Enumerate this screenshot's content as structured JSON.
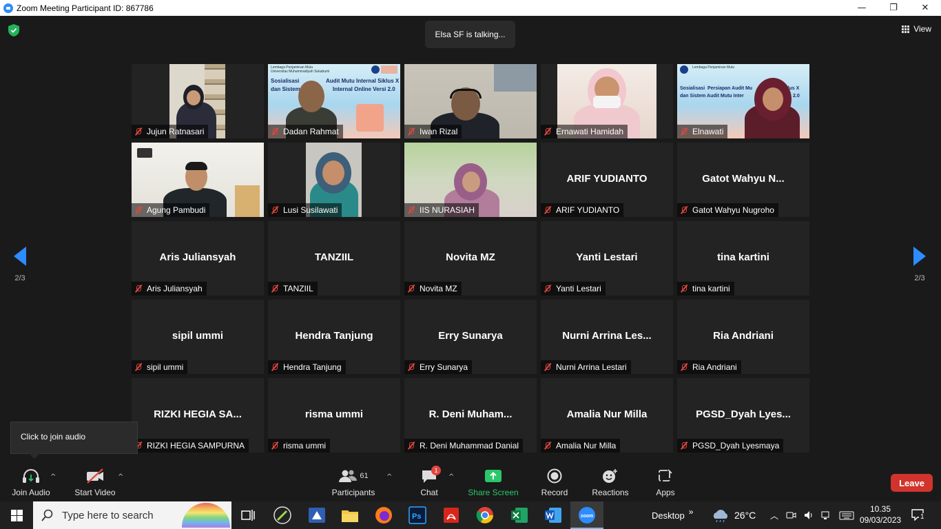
{
  "window": {
    "title": "Zoom Meeting Participant ID: 867786",
    "minimize": "—",
    "restore": "❐",
    "close": "✕"
  },
  "meeting": {
    "talking": "Elsa SF is talking...",
    "view_label": "View",
    "page_left": "2/3",
    "page_right": "2/3"
  },
  "participants": [
    {
      "name": "Jujun Ratnasari",
      "video": true,
      "bg": "#d8d4c8"
    },
    {
      "name": "Dadan Rahmat",
      "video": true,
      "bg": "#6fb2d8"
    },
    {
      "name": "Iwan Rizal",
      "video": true,
      "bg": "#c9c4bb"
    },
    {
      "name": "Ernawati Hamidah",
      "video": true,
      "bg": "#efe5dd"
    },
    {
      "name": "Elnawati",
      "video": true,
      "bg": "#7fbde0"
    },
    {
      "name": "Agung Pambudi",
      "video": true,
      "bg": "#ecebe6"
    },
    {
      "name": "Lusi Susilawati",
      "video": true,
      "bg": "#c6c4be"
    },
    {
      "name": "IIS NURASIAH",
      "video": true,
      "bg": "#a9c88f"
    },
    {
      "name": "ARIF YUDIANTO",
      "display": "ARIF YUDIANTO",
      "video": false
    },
    {
      "name": "Gatot Wahyu Nugroho",
      "display": "Gatot Wahyu N...",
      "video": false
    },
    {
      "name": "Aris Juliansyah",
      "display": "Aris Juliansyah",
      "video": false
    },
    {
      "name": "TANZIIL",
      "display": "TANZIIL",
      "video": false
    },
    {
      "name": "Novita MZ",
      "display": "Novita MZ",
      "video": false
    },
    {
      "name": "Yanti Lestari",
      "display": "Yanti Lestari",
      "video": false
    },
    {
      "name": "tina kartini",
      "display": "tina kartini",
      "video": false
    },
    {
      "name": "sipil ummi",
      "display": "sipil ummi",
      "video": false
    },
    {
      "name": "Hendra Tanjung",
      "display": "Hendra Tanjung",
      "video": false
    },
    {
      "name": "Erry Sunarya",
      "display": "Erry Sunarya",
      "video": false
    },
    {
      "name": "Nurni Arrina Lestari",
      "display": "Nurni Arrina Les...",
      "video": false
    },
    {
      "name": "Ria Andriani",
      "display": "Ria Andriani",
      "video": false
    },
    {
      "name": "RIZKI HEGIA SAMPURNA",
      "display": "RIZKI HEGIA SA...",
      "video": false
    },
    {
      "name": "risma ummi",
      "display": "risma ummi",
      "video": false
    },
    {
      "name": "R. Deni Muhammad Danial",
      "display": "R. Deni Muham...",
      "video": false
    },
    {
      "name": "Amalia Nur Milla",
      "display": "Amalia Nur Milla",
      "video": false
    },
    {
      "name": "PGSD_Dyah Lyesmaya",
      "display": "PGSD_Dyah  Lyes...",
      "video": false
    }
  ],
  "slides": {
    "line1": "Sosialisasi",
    "dadan_l1": "Audit Mutu Internal Siklus X",
    "dadan_l2a": "dan",
    "dadan_l2b": "Sistem",
    "dadan_l2c": "Internal Online",
    "dadan_l2d": "Versi 2.0",
    "elna_l1": "Persiapan Audit Mu",
    "elna_l1b": "Siklus X",
    "elna_l2a": "dan",
    "elna_l2b": "Sistem Audit Mutu Inter",
    "elna_l2c": "2.0",
    "org1": "Lembaga Penjaminan Mutu",
    "org2": "Universitas Muhammadiyah Sukabumi"
  },
  "tooltip": "Click to join audio",
  "toolbar": {
    "join_audio": "Join Audio",
    "start_video": "Start Video",
    "participants": "Participants",
    "participants_count": "61",
    "chat": "Chat",
    "chat_badge": "1",
    "share_screen": "Share Screen",
    "record": "Record",
    "reactions": "Reactions",
    "apps": "Apps",
    "leave": "Leave",
    "caret": "^"
  },
  "taskbar": {
    "search_placeholder": "Type here to search",
    "desktop": "Desktop",
    "chevron": "»",
    "temperature": "26°C",
    "time": "10.35",
    "date": "09/03/2023",
    "notif_count": "1"
  },
  "colors": {
    "accent": "#2d8cff",
    "leave": "#d0342c",
    "share": "#2ac76b",
    "mute": "#e0463e"
  }
}
